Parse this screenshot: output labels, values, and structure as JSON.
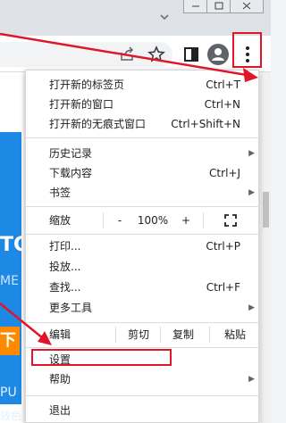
{
  "menu": {
    "new_tab": {
      "label": "打开新的标签页",
      "shortcut": "Ctrl+T"
    },
    "new_window": {
      "label": "打开新的窗口",
      "shortcut": "Ctrl+N"
    },
    "incognito": {
      "label": "打开新的无痕式窗口",
      "shortcut": "Ctrl+Shift+N"
    },
    "history": {
      "label": "历史记录"
    },
    "downloads": {
      "label": "下载内容",
      "shortcut": "Ctrl+J"
    },
    "bookmarks": {
      "label": "书签"
    },
    "zoom": {
      "label": "缩放",
      "minus": "-",
      "value": "100%",
      "plus": "+"
    },
    "print": {
      "label": "打印...",
      "shortcut": "Ctrl+P"
    },
    "cast": {
      "label": "投放..."
    },
    "find": {
      "label": "查找...",
      "shortcut": "Ctrl+F"
    },
    "more_tools": {
      "label": "更多工具"
    },
    "edit": {
      "label": "编辑",
      "cut": "剪切",
      "copy": "复制",
      "paste": "粘贴"
    },
    "settings": {
      "label": "设置"
    },
    "help": {
      "label": "帮助"
    },
    "exit": {
      "label": "退出"
    }
  },
  "background": {
    "text1": "TC",
    "text2": "ME",
    "button": "下",
    "text3": "PU",
    "text4": "效色"
  },
  "icons": [
    "share-icon",
    "star-icon",
    "side-panel-icon",
    "profile-avatar",
    "menu-kebab-icon",
    "fullscreen-icon"
  ],
  "colors": {
    "highlight": "#e0162b",
    "blue_panel": "#1e88e5",
    "orange": "#ff8a00"
  }
}
